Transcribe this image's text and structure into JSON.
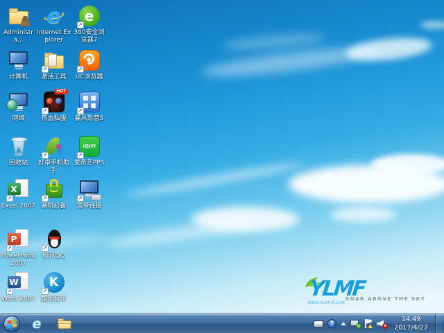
{
  "desktop": {
    "shortcut_arrow_glyph": "↗",
    "icons": [
      {
        "id": "administrator-folder",
        "label": "Administra...",
        "glyph": "folder-user",
        "shortcut": false,
        "row": 1,
        "col": 1
      },
      {
        "id": "internet-explorer",
        "label": "Internet Explorer",
        "glyph": "ie",
        "glyph_text": "e",
        "shortcut": false,
        "row": 1,
        "col": 2
      },
      {
        "id": "360-safe-browser",
        "label": "360安全浏览器7",
        "glyph": "se360",
        "glyph_text": "e",
        "shortcut": true,
        "row": 1,
        "col": 3
      },
      {
        "id": "computer",
        "label": "计算机",
        "glyph": "computer",
        "shortcut": false,
        "row": 2,
        "col": 1
      },
      {
        "id": "activation-tools",
        "label": "激活工具",
        "glyph": "folder",
        "shortcut": true,
        "row": 2,
        "col": 2
      },
      {
        "id": "uc-browser",
        "label": "UC浏览器",
        "glyph": "uc",
        "shortcut": true,
        "row": 2,
        "col": 3
      },
      {
        "id": "network",
        "label": "网络",
        "glyph": "network",
        "shortcut": false,
        "row": 3,
        "col": 1
      },
      {
        "id": "rexue-sifu-game",
        "label": "热血私服",
        "glyph": "game",
        "badge": "HOT",
        "shortcut": true,
        "row": 3,
        "col": 2
      },
      {
        "id": "baofeng-player-5",
        "label": "暴风影音5",
        "glyph": "storm",
        "shortcut": true,
        "row": 3,
        "col": 3
      },
      {
        "id": "recycle-bin",
        "label": "回收站",
        "glyph": "bin",
        "shortcut": false,
        "row": 4,
        "col": 1
      },
      {
        "id": "haozhuo-phone-assistant",
        "label": "好卓手机助手",
        "glyph": "zhuo",
        "shortcut": true,
        "row": 4,
        "col": 2
      },
      {
        "id": "iqiyi-pps",
        "label": "爱奇艺PPS",
        "glyph": "pps",
        "glyph_text": "iQIYI",
        "shortcut": true,
        "row": 4,
        "col": 3
      },
      {
        "id": "excel-2007",
        "label": "Excel 2007",
        "glyph": "excel",
        "glyph_text": "X",
        "shortcut": true,
        "row": 5,
        "col": 1
      },
      {
        "id": "zhuangji-bibei",
        "label": "装机必备",
        "glyph": "bag",
        "shortcut": true,
        "row": 5,
        "col": 2
      },
      {
        "id": "broadband-connection",
        "label": "宽带连接",
        "glyph": "broadband",
        "shortcut": true,
        "row": 5,
        "col": 3
      },
      {
        "id": "powerpoint-2007",
        "label": "PowerPoint 2007",
        "glyph": "ppt",
        "glyph_text": "P",
        "shortcut": true,
        "row": 6,
        "col": 1
      },
      {
        "id": "tencent-qq",
        "label": "腾讯QQ",
        "glyph": "qq",
        "shortcut": true,
        "row": 6,
        "col": 2
      },
      {
        "id": "word-2007",
        "label": "Word 2007",
        "glyph": "word",
        "glyph_text": "W",
        "shortcut": true,
        "row": 7,
        "col": 1
      },
      {
        "id": "kugou-music",
        "label": "酷狗音乐",
        "glyph": "kugou",
        "glyph_text": "K",
        "shortcut": true,
        "row": 7,
        "col": 2
      }
    ]
  },
  "wallpaper_logo": {
    "brand": "YLMF",
    "tagline": "SOAR ABOVE THE SKY",
    "url": "WWW.YLMF-Z.COM"
  },
  "taskbar": {
    "ie_glyph": "e",
    "tray": {
      "help_glyph": "?",
      "mute_glyph": "×",
      "clock": {
        "time": "14:49",
        "date": "2017/4/27"
      }
    }
  },
  "colors": {
    "sky_top": "#0f6fb4",
    "sky_bottom": "#f2fafc",
    "taskbar_blue": "#3e6b9e",
    "logo_blue": "#169fe0",
    "logo_leaf_green": "#6abf2e"
  }
}
